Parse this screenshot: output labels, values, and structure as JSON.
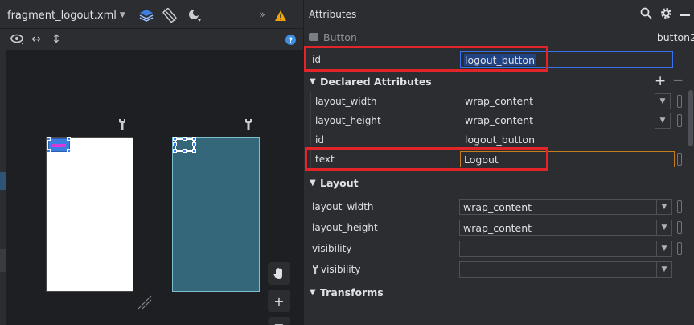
{
  "editor": {
    "file_tab": "fragment_logout.xml",
    "icons": [
      "chevron-down-icon",
      "layers-icon",
      "orientation-icon",
      "theme-icon",
      "overflow-icon",
      "warning-icon",
      "eye-icon",
      "horizontal-resize-icon",
      "vertical-resize-icon",
      "help-icon",
      "wrench-icon",
      "pan-icon",
      "zoom-in-icon",
      "zoom-out-icon"
    ]
  },
  "attributes": {
    "title": "Attributes",
    "component_type": "Button",
    "component_name": "button2",
    "id_row": {
      "label": "id",
      "value": "logout_button"
    },
    "declared": {
      "title": "Declared Attributes",
      "rows": [
        {
          "label": "layout_width",
          "value": "wrap_content"
        },
        {
          "label": "layout_height",
          "value": "wrap_content"
        },
        {
          "label": "id",
          "value": "logout_button"
        },
        {
          "label": "text",
          "value": "Logout"
        }
      ]
    },
    "layout": {
      "title": "Layout",
      "rows": [
        {
          "label": "layout_width",
          "value": "wrap_content"
        },
        {
          "label": "layout_height",
          "value": "wrap_content"
        },
        {
          "label": "visibility",
          "value": ""
        },
        {
          "label": "visibility",
          "value": ""
        }
      ]
    },
    "transforms": {
      "title": "Transforms"
    }
  },
  "colors": {
    "background": "#2b2d30",
    "canvas": "#1e1f22",
    "highlight": "#e3252a",
    "selection": "#214283",
    "blueprint": "#336779"
  }
}
